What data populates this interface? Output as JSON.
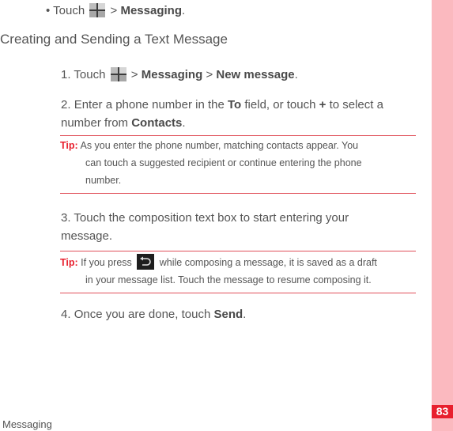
{
  "bullet": {
    "prefix": "• Touch",
    "sep": ">",
    "target": "Messaging",
    "end": "."
  },
  "heading": "Creating and Sending a Text Message",
  "steps": [
    {
      "num": "1.",
      "text_a": "Touch",
      "sep1": ">",
      "bold1": "Messaging",
      "sep2": ">",
      "bold2": "New message",
      "end": "."
    },
    {
      "num": "2.",
      "line1_a": "Enter a phone number in the",
      "bold_to": "To",
      "line1_b": "field, or touch",
      "bold_plus": "+",
      "line1_c": "to select a",
      "line2_a": "number from",
      "bold_contacts": "Contacts",
      "end": "."
    },
    {
      "num": "3.",
      "line1": "Touch the composition text box to start entering your",
      "line2": "message."
    },
    {
      "num": "4.",
      "text": "Once you are done, touch",
      "bold": "Send",
      "end": "."
    }
  ],
  "tips": [
    {
      "label": "Tip:",
      "line1": "As you enter the phone number, matching contacts appear. You",
      "line2": "can touch a suggested recipient or continue entering the phone",
      "line3": "number."
    },
    {
      "label": "Tip:",
      "line1_a": "If you press",
      "line1_b": "while composing a message, it is saved as a draft",
      "line2": "in your message list. Touch the message to resume composing it."
    }
  ],
  "icons": {
    "apps": "apps-grid-icon",
    "back": "back-icon"
  },
  "footer": {
    "section": "Messaging",
    "page_number": "83"
  },
  "colors": {
    "accent_red": "#e8202e",
    "sidebar_pink": "#fbb9bf",
    "rule_red": "#e0505a",
    "text_gray": "#555555"
  }
}
